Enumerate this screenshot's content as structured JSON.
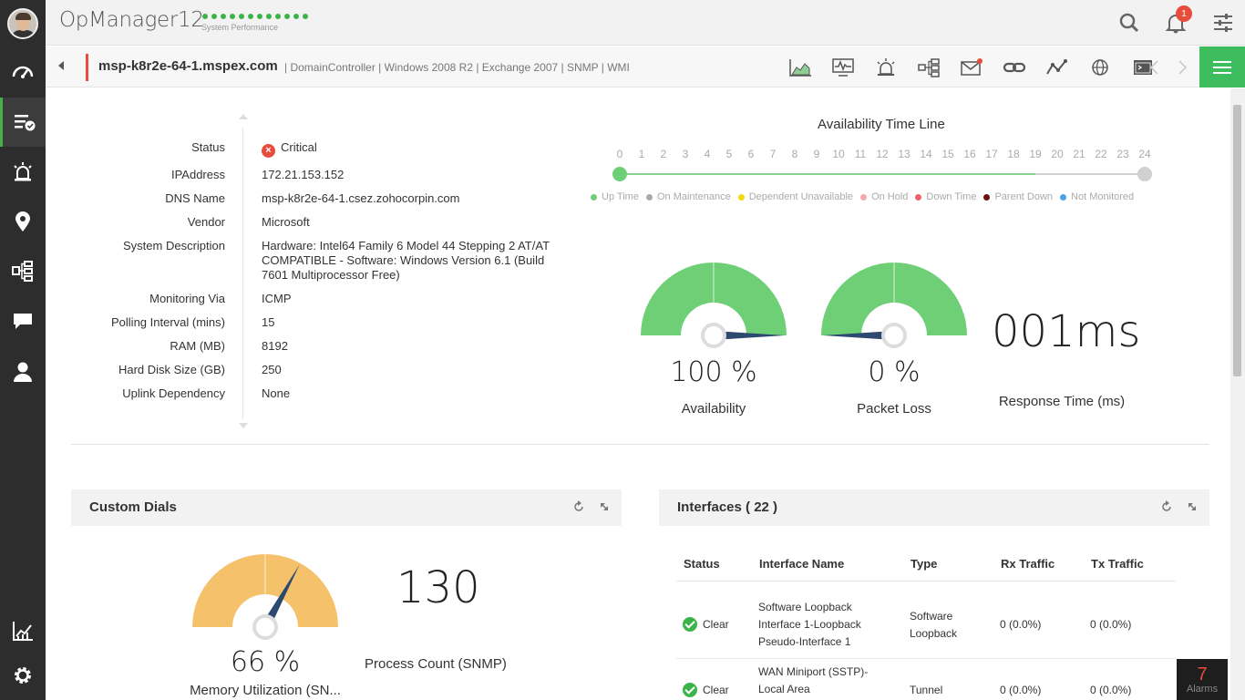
{
  "header": {
    "app_title": "OpManager12",
    "perf_label": "System Performance",
    "notification_count": "1"
  },
  "device": {
    "name": "msp-k8r2e-64-1.mspex.com",
    "tags": "| DomainController | Windows 2008 R2 | Exchange 2007 | SNMP | WMI"
  },
  "info": [
    {
      "key": "Status",
      "value": "Critical"
    },
    {
      "key": "IPAddress",
      "value": "172.21.153.152"
    },
    {
      "key": "DNS Name",
      "value": "msp-k8r2e-64-1.csez.zohocorpin.com"
    },
    {
      "key": "Vendor",
      "value": "Microsoft"
    },
    {
      "key": "System Description",
      "value": "Hardware: Intel64 Family 6 Model 44 Stepping 2 AT/AT COMPATIBLE - Software: Windows Version 6.1 (Build 7601 Multiprocessor Free)"
    },
    {
      "key": "Monitoring Via",
      "value": "ICMP"
    },
    {
      "key": "Polling Interval (mins)",
      "value": "15"
    },
    {
      "key": "RAM (MB)",
      "value": "8192"
    },
    {
      "key": "Hard Disk Size (GB)",
      "value": "250"
    },
    {
      "key": "Uplink Dependency",
      "value": "None"
    }
  ],
  "availability": {
    "title": "Availability Time Line",
    "hours": [
      "0",
      "1",
      "2",
      "3",
      "4",
      "5",
      "6",
      "7",
      "8",
      "9",
      "10",
      "11",
      "12",
      "13",
      "14",
      "15",
      "16",
      "17",
      "18",
      "19",
      "20",
      "21",
      "22",
      "23",
      "24"
    ],
    "legend": [
      {
        "label": "Up Time",
        "color": "#6fcf77"
      },
      {
        "label": "On Maintenance",
        "color": "#aaaaaa"
      },
      {
        "label": "Dependent Unavailable",
        "color": "#f5d70a"
      },
      {
        "label": "On Hold",
        "color": "#f4a8a8"
      },
      {
        "label": "Down Time",
        "color": "#f0606a"
      },
      {
        "label": "Parent Down",
        "color": "#6b0f0f"
      },
      {
        "label": "Not Monitored",
        "color": "#4aa3e8"
      }
    ]
  },
  "gauges": {
    "availability_value": "100 %",
    "availability_label": "Availability",
    "availability_fraction": 1.0,
    "packet_loss_value": "0 %",
    "packet_loss_label": "Packet Loss",
    "packet_loss_fraction": 0.0,
    "response_value": "001ms",
    "response_label": "Response Time (ms)"
  },
  "custom_dials": {
    "title": "Custom Dials",
    "memory_value": "66 %",
    "memory_label": "Memory Utilization (SN...",
    "memory_fraction": 0.66,
    "process_count": "130",
    "process_label": "Process Count (SNMP)"
  },
  "interfaces": {
    "title": "Interfaces ( 22 )",
    "columns": [
      "Status",
      "Interface Name",
      "Type",
      "Rx Traffic",
      "Tx Traffic"
    ],
    "rows": [
      {
        "status": "Clear",
        "name": "Software Loopback Interface 1-Loopback Pseudo-Interface 1",
        "type": "Software Loopback",
        "rx": "0 (0.0%)",
        "tx": "0 (0.0%)"
      },
      {
        "status": "Clear",
        "name": "WAN Miniport (SSTP)-Local Area",
        "type": "Tunnel",
        "rx": "0 (0.0%)",
        "tx": "0 (0.0%)"
      }
    ]
  },
  "alarms": {
    "count": "7",
    "label": "Alarms"
  },
  "colors": {
    "green": "#6fcf77",
    "gauge_orange": "#f5c26b",
    "needle": "#2c4a70",
    "critical": "#e74c3c"
  }
}
